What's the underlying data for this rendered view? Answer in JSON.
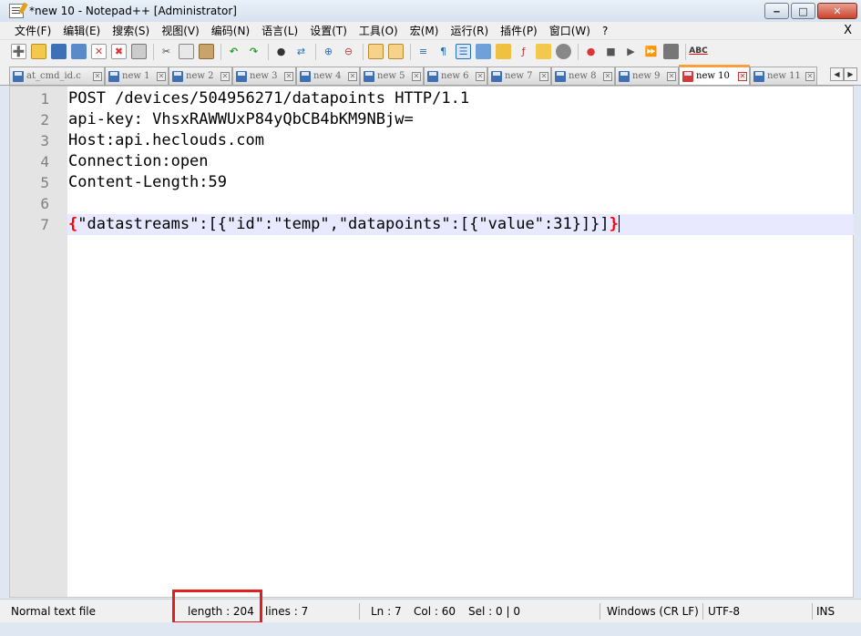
{
  "window": {
    "title": "*new 10 - Notepad++ [Administrator]"
  },
  "menu": {
    "items": [
      "文件(F)",
      "编辑(E)",
      "搜索(S)",
      "视图(V)",
      "编码(N)",
      "语言(L)",
      "设置(T)",
      "工具(O)",
      "宏(M)",
      "运行(R)",
      "插件(P)",
      "窗口(W)",
      "?"
    ],
    "close_label": "X"
  },
  "tabs": [
    {
      "label": "at_cmd_id.c",
      "active": false
    },
    {
      "label": "new 1",
      "active": false
    },
    {
      "label": "new 2",
      "active": false
    },
    {
      "label": "new 3",
      "active": false
    },
    {
      "label": "new 4",
      "active": false
    },
    {
      "label": "new 5",
      "active": false
    },
    {
      "label": "new 6",
      "active": false
    },
    {
      "label": "new 7",
      "active": false
    },
    {
      "label": "new 8",
      "active": false
    },
    {
      "label": "new 9",
      "active": false
    },
    {
      "label": "new 10",
      "active": true
    },
    {
      "label": "new 11",
      "active": false
    }
  ],
  "editor": {
    "lines": [
      {
        "num": "1",
        "text": "POST /devices/504956271/datapoints HTTP/1.1"
      },
      {
        "num": "2",
        "text": "api-key: VhsxRAWWUxP84yQbCB4bKM9NBjw="
      },
      {
        "num": "3",
        "text": "Host:api.heclouds.com"
      },
      {
        "num": "4",
        "text": "Connection:open"
      },
      {
        "num": "5",
        "text": "Content-Length:59"
      },
      {
        "num": "6",
        "text": ""
      },
      {
        "num": "7",
        "open_brace": "{",
        "text": "\"datastreams\":[{\"id\":\"temp\",\"datapoints\":[{\"value\":31}]}]",
        "close_brace": "}"
      }
    ],
    "current_line": 7
  },
  "status": {
    "file_type": "Normal text file",
    "length": "length : 204",
    "lines": "lines : 7",
    "ln": "Ln : 7",
    "col": "Col : 60",
    "sel": "Sel : 0 | 0",
    "eol": "Windows (CR LF)",
    "encoding": "UTF-8",
    "mode": "INS"
  },
  "colors": {
    "brace_match": "#ff0000",
    "current_line": "#e8e8ff",
    "active_tab_accent": "#f9a03c",
    "highlight_box": "#e02020"
  }
}
